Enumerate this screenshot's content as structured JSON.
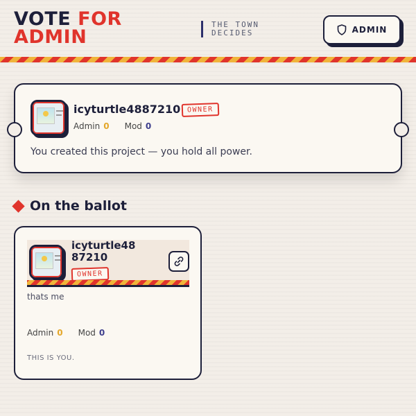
{
  "header": {
    "logo_line1_a": "VOTE",
    "logo_line1_b": "FOR",
    "logo_line2": "ADMIN",
    "tagline_line1": "THE TOWN",
    "tagline_line2": "DECIDES",
    "admin_button_label": "ADMIN",
    "admin_button_icon": "shield-icon"
  },
  "colors": {
    "accent_red": "#e0342c",
    "accent_yellow": "#f0b43a",
    "ink": "#1d1f3a",
    "admin_count": "#e4a72a",
    "mod_count": "#3e3f8d"
  },
  "owner_card": {
    "username": "icyturtle4887210",
    "badge": "OWNER",
    "admin_label": "Admin",
    "admin_count": "0",
    "mod_label": "Mod",
    "mod_count": "0",
    "description": "You created this project — you hold all power."
  },
  "ballot_section": {
    "title": "On the ballot",
    "candidates": [
      {
        "username": "icyturtle4887210",
        "badge": "OWNER",
        "bio": "thats me",
        "admin_label": "Admin",
        "admin_count": "0",
        "mod_label": "Mod",
        "mod_count": "0",
        "note": "THIS IS YOU.",
        "link_icon": "link-icon"
      }
    ]
  }
}
